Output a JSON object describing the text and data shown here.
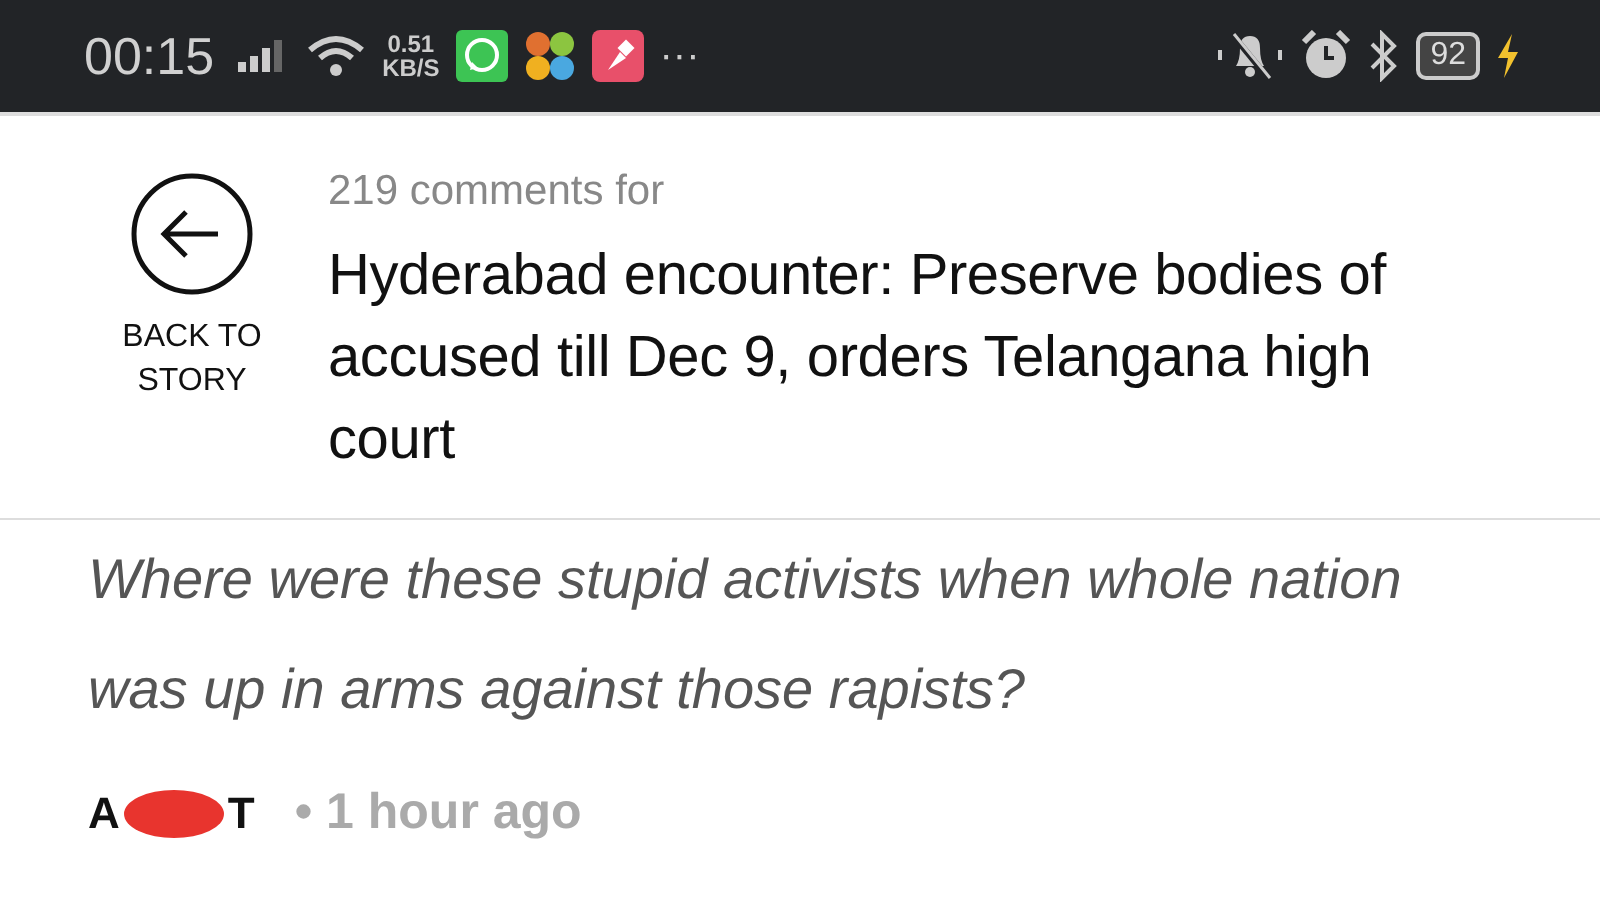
{
  "status_bar": {
    "time": "00:15",
    "net_speed": [
      "0.51",
      "KB/S"
    ],
    "more": "···",
    "battery": "92"
  },
  "header": {
    "back_label": "BACK TO STORY",
    "comments_count": "219 comments for",
    "article_title": "Hyderabad encounter: Preserve bodies of accused till Dec 9, orders Telangana high court"
  },
  "comment": {
    "text": "Where were these stupid activists when whole nation was up in arms against those rapists?",
    "author": [
      "A",
      "T"
    ],
    "time": "• 1 hour ago"
  }
}
